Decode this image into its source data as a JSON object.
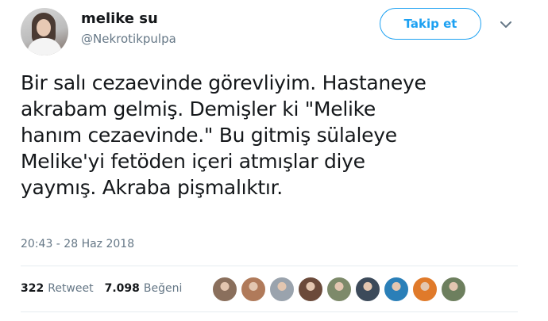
{
  "user": {
    "display_name": "melike su",
    "handle": "@Nekrotikpulpa",
    "avatar_icon": "profile-photo"
  },
  "actions": {
    "follow_label": "Takip et",
    "menu_icon": "chevron-down-icon"
  },
  "tweet": {
    "text": "Bir salı cezaevinde görevliyim. Hastaneye\nakrabam gelmiş. Demişler ki \"Melike\nhanım cezaevinde.\"  Bu gitmiş sülaleye\nMelike'yi fetöden içeri atmışlar diye\nyaymış. Akraba pişmalıktır."
  },
  "meta": {
    "timestamp": "20:43 - 28 Haz 2018"
  },
  "stats": {
    "retweets": {
      "count": "322",
      "label": "Retweet"
    },
    "likes": {
      "count": "7.098",
      "label": "Beğeni"
    }
  },
  "likers": [
    {
      "name": "liker-1",
      "color": "#8a6f5c"
    },
    {
      "name": "liker-2",
      "color": "#b07a5a"
    },
    {
      "name": "liker-3",
      "color": "#9aa3ad"
    },
    {
      "name": "liker-4",
      "color": "#6b4a3a"
    },
    {
      "name": "liker-5",
      "color": "#7d8a6a"
    },
    {
      "name": "liker-6",
      "color": "#3c4a5a"
    },
    {
      "name": "liker-7",
      "color": "#2a7fb8"
    },
    {
      "name": "liker-8",
      "color": "#e07a2a"
    },
    {
      "name": "liker-9",
      "color": "#6d7f5e"
    }
  ],
  "colors": {
    "accent": "#1da1f2",
    "text": "#14171a",
    "muted": "#657786",
    "divider": "#e6ecf0"
  }
}
